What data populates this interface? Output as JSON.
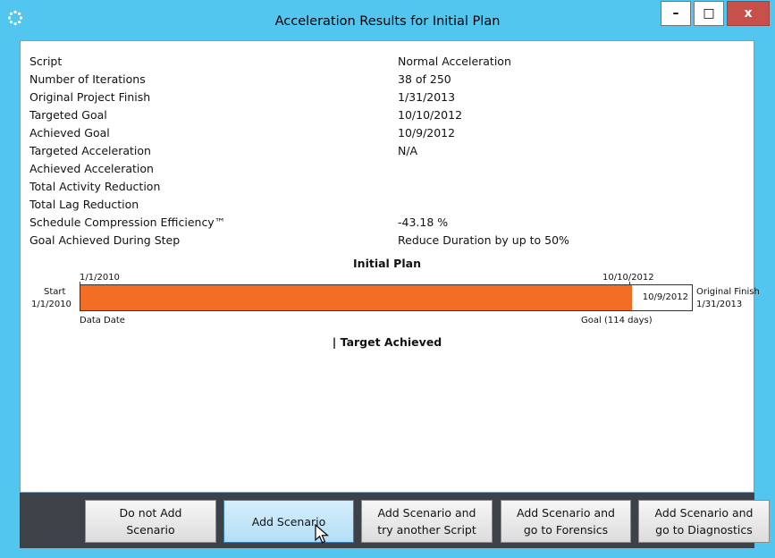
{
  "window": {
    "title": "Acceleration Results for Initial  Plan",
    "controls": {
      "minimize": "–",
      "maximize": "□",
      "close": "x"
    }
  },
  "results": [
    {
      "label": "Script",
      "value": "Normal Acceleration"
    },
    {
      "label": "Number of Iterations",
      "value": "38 of 250"
    },
    {
      "label": "Original Project Finish",
      "value": "1/31/2013"
    },
    {
      "label": "Targeted Goal",
      "value": "10/10/2012"
    },
    {
      "label": "Achieved Goal",
      "value": "10/9/2012"
    },
    {
      "label": "Targeted Acceleration",
      "value": "N/A"
    },
    {
      "label": "Achieved Acceleration",
      "value": ""
    },
    {
      "label": "Total Activity Reduction",
      "value": ""
    },
    {
      "label": "Total Lag Reduction",
      "value": ""
    },
    {
      "label": "Schedule Compression Efficiency™",
      "value": "-43.18 %"
    },
    {
      "label": "Goal Achieved During Step",
      "value": "Reduce Duration by up to 50%"
    }
  ],
  "timeline": {
    "title": "Initial  Plan",
    "start_date_top": "1/1/2010",
    "goal_date_top": "10/10/2012",
    "start_label": "Start",
    "start_date": "1/1/2010",
    "achieved_inside": "10/9/2012",
    "original_finish_label": "Original Finish",
    "original_finish_date": "1/31/2013",
    "data_date_label": "Data Date",
    "goal_label": "Goal (114 days)",
    "fill_fraction": 0.902,
    "fill_color": "#f26e24"
  },
  "status": "| Target Achieved",
  "buttons": {
    "do_not_add": [
      "Do not Add",
      "Scenario"
    ],
    "add_scenario": "Add Scenario",
    "add_try_script": [
      "Add Scenario and",
      "try another Script"
    ],
    "add_forensics": [
      "Add Scenario and",
      "go to Forensics"
    ],
    "add_diagnostics": [
      "Add Scenario and",
      "go to Diagnostics"
    ]
  },
  "colors": {
    "titlebar": "#53c6ef",
    "close": "#c7504b",
    "button_bar": "#3d4148"
  }
}
